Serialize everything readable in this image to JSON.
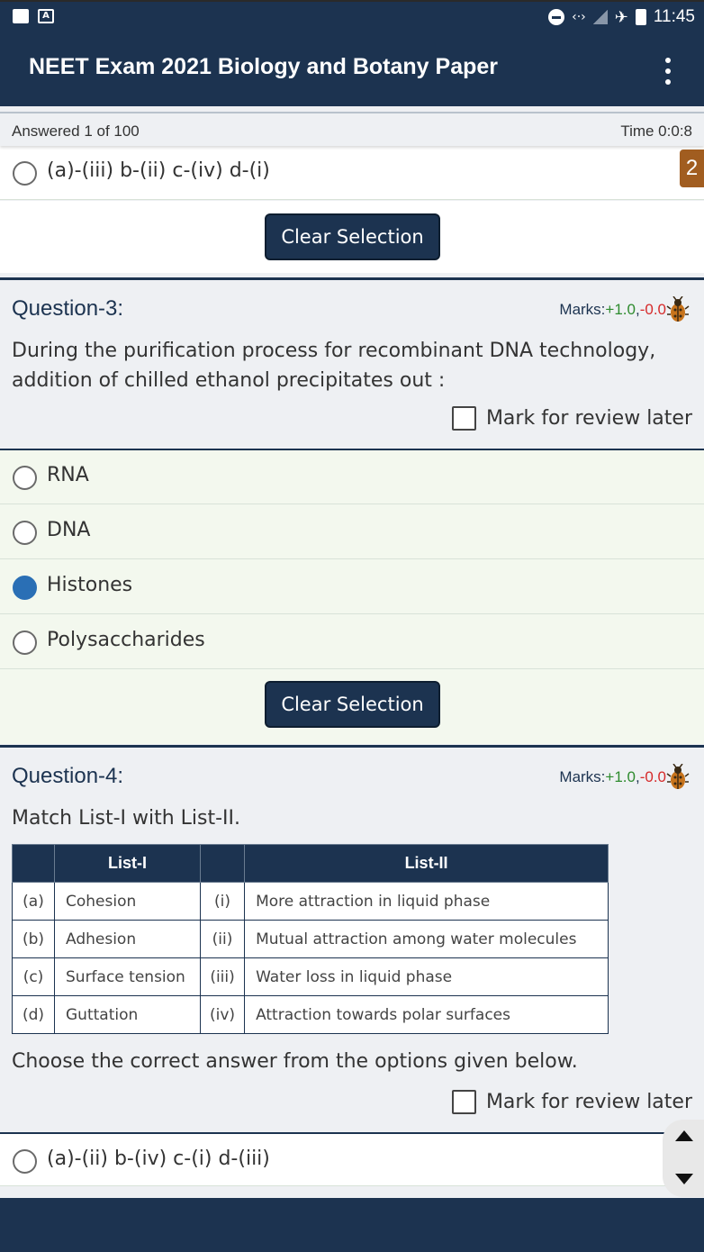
{
  "status_bar": {
    "time": "11:45",
    "icons": [
      "image-icon",
      "a-icon",
      "dnd-icon",
      "data-saver-icon",
      "no-signal-icon",
      "airplane-icon",
      "battery-charging-icon"
    ]
  },
  "app_bar": {
    "title": "NEET Exam 2021 Biology and Botany Paper",
    "menu_icon": "overflow-menu-icon"
  },
  "info_bar": {
    "answered": "Answered 1 of 100",
    "time": "Time 0:0:8"
  },
  "side_badge": "2",
  "colors": {
    "primary": "#1c3350",
    "selected_radio": "#2a6fb5",
    "positive_marks": "#2e8b2e",
    "negative_marks": "#d62b2b",
    "badge": "#a15d20"
  },
  "question_2": {
    "last_option": "(a)-(iii) b-(ii) c-(iv) d-(i)",
    "clear_label": "Clear Selection"
  },
  "question_3": {
    "title": "Question-3:",
    "marks_label": "Marks:",
    "marks_pos": "+1.0",
    "marks_sep": ",",
    "marks_neg": "-0.0",
    "text": "During the purification process for recombinant DNA technology, addition of chilled ethanol precipitates out :",
    "review_label": "Mark for review later",
    "options": [
      {
        "label": "RNA",
        "selected": false
      },
      {
        "label": "DNA",
        "selected": false
      },
      {
        "label": "Histones",
        "selected": true
      },
      {
        "label": "Polysaccharides",
        "selected": false
      }
    ],
    "clear_label": "Clear Selection"
  },
  "question_4": {
    "title": "Question-4:",
    "marks_label": "Marks:",
    "marks_pos": "+1.0",
    "marks_sep": ",",
    "marks_neg": "-0.0",
    "text": "Match List-I with List-II.",
    "table": {
      "headers": [
        "",
        "List-I",
        "",
        "List-II"
      ],
      "rows": [
        [
          "(a)",
          "Cohesion",
          "(i)",
          "More attraction in liquid phase"
        ],
        [
          "(b)",
          "Adhesion",
          "(ii)",
          "Mutual attraction among water molecules"
        ],
        [
          "(c)",
          "Surface tension",
          "(iii)",
          "Water loss in liquid phase"
        ],
        [
          "(d)",
          "Guttation",
          "(iv)",
          "Attraction towards polar surfaces"
        ]
      ]
    },
    "footer_text": "Choose the correct answer from the options given below.",
    "review_label": "Mark for review later",
    "first_option": "(a)-(ii) b-(iv) c-(i) d-(iii)"
  }
}
